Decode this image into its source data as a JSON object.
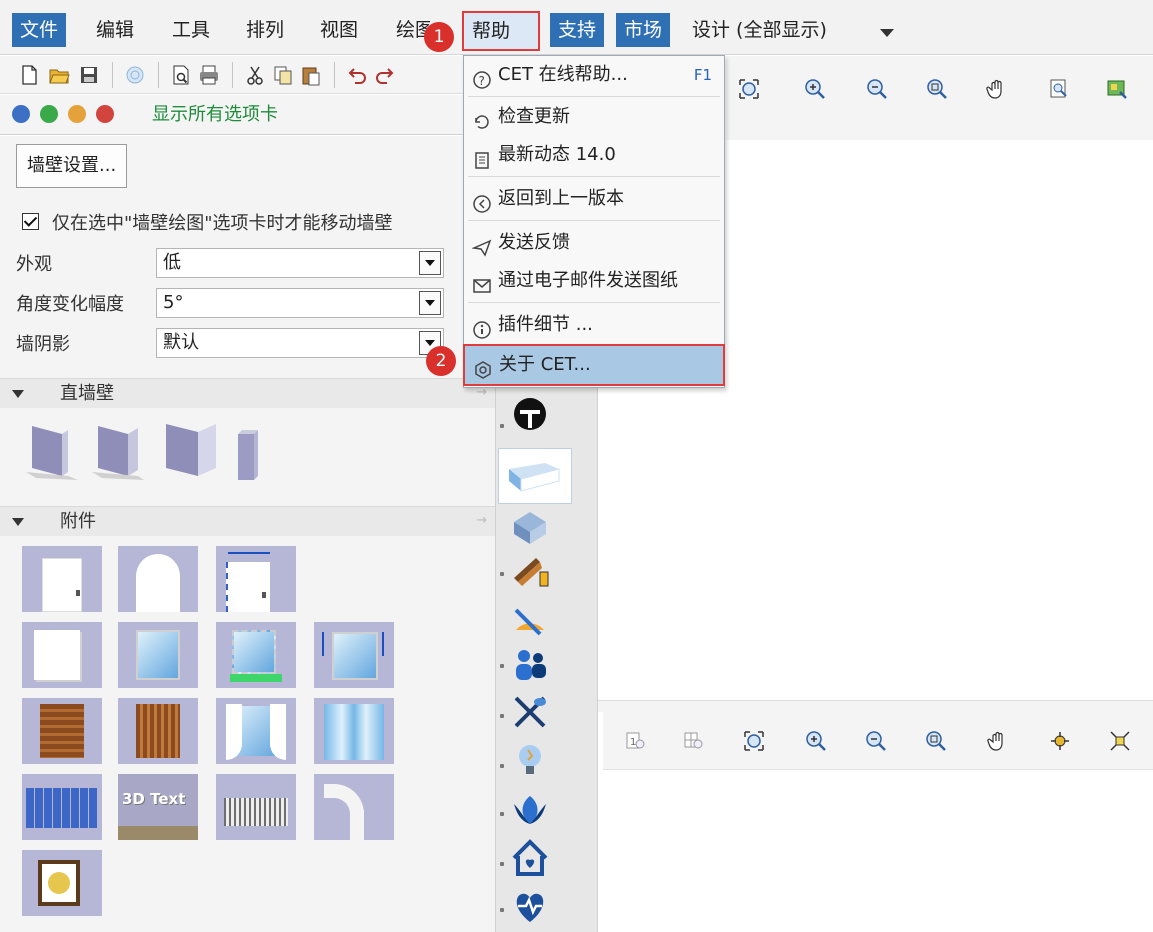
{
  "menubar": {
    "items": [
      {
        "label": "文件",
        "active": true
      },
      {
        "label": "编辑"
      },
      {
        "label": "工具"
      },
      {
        "label": "排列"
      },
      {
        "label": "视图"
      },
      {
        "label": "绘图"
      },
      {
        "label": "帮助",
        "highlight": true
      },
      {
        "label": "支持",
        "active": true
      },
      {
        "label": "市场",
        "active": true
      },
      {
        "label": "设计 (全部显示)"
      }
    ]
  },
  "callouts": {
    "step1": "1",
    "step2": "2"
  },
  "tabs_row": {
    "label": "显示所有选项卡"
  },
  "wall_panel": {
    "settings_button": "墙壁设置...",
    "checkbox_label": "仅在选中\"墙壁绘图\"选项卡时才能移动墙壁",
    "fields": [
      {
        "label": "外观",
        "value": "低"
      },
      {
        "label": "角度变化幅度",
        "value": "5°"
      },
      {
        "label": "墙阴影",
        "value": "默认"
      }
    ],
    "sections": {
      "straight_walls": "直墙壁",
      "attachments": "附件"
    },
    "tile_3dtext": "3D Text"
  },
  "help_menu": {
    "items": [
      {
        "label": "CET 在线帮助...",
        "shortcut": "F1",
        "icon": "question-icon"
      },
      {
        "label": "检查更新",
        "icon": "update-icon"
      },
      {
        "label": "最新动态 14.0",
        "icon": "news-icon"
      },
      {
        "label": "返回到上一版本",
        "icon": "revert-icon"
      },
      {
        "label": "发送反馈",
        "icon": "feedback-icon"
      },
      {
        "label": "通过电子邮件发送图纸",
        "icon": "mail-icon"
      },
      {
        "label": "插件细节 ...",
        "icon": "info-icon"
      },
      {
        "label": "关于 CET...",
        "icon": "about-icon"
      }
    ]
  },
  "colors": {
    "accent": "#2f6fb3",
    "highlight_border": "#e03c3c",
    "callout": "#d9302c",
    "tab_green": "#1e8c3a",
    "menu_highlight": "#a9c8e4"
  }
}
